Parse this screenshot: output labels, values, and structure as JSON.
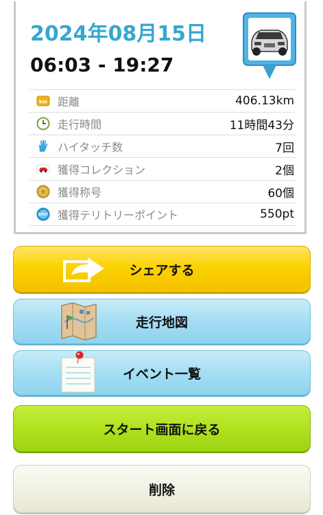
{
  "summary": {
    "date": "2024年08月15日",
    "time_range": "06:03 - 19:27"
  },
  "stats": [
    {
      "icon": "km-icon",
      "label": "距離",
      "value": "406.13km"
    },
    {
      "icon": "clock-icon",
      "label": "走行時間",
      "value": "11時間43分"
    },
    {
      "icon": "hand-icon",
      "label": "ハイタッチ数",
      "value": "7回"
    },
    {
      "icon": "car-collection-icon",
      "label": "獲得コレクション",
      "value": "2個"
    },
    {
      "icon": "medal-icon",
      "label": "獲得称号",
      "value": "60個"
    },
    {
      "icon": "spot-icon",
      "label": "獲得テリトリーポイント",
      "value": "550pt"
    }
  ],
  "buttons": {
    "share": "シェアする",
    "map": "走行地図",
    "events": "イベント一覧",
    "back_to_start": "スタート画面に戻る",
    "delete": "削除"
  },
  "icons": {
    "km_badge": "km",
    "spot_badge": "SPOT"
  },
  "colors": {
    "date": "#35a8cf",
    "share": "#fbd200",
    "blue_button": "#a4def3",
    "start_button": "#aee01b",
    "delete_button": "#f0f0e2"
  }
}
